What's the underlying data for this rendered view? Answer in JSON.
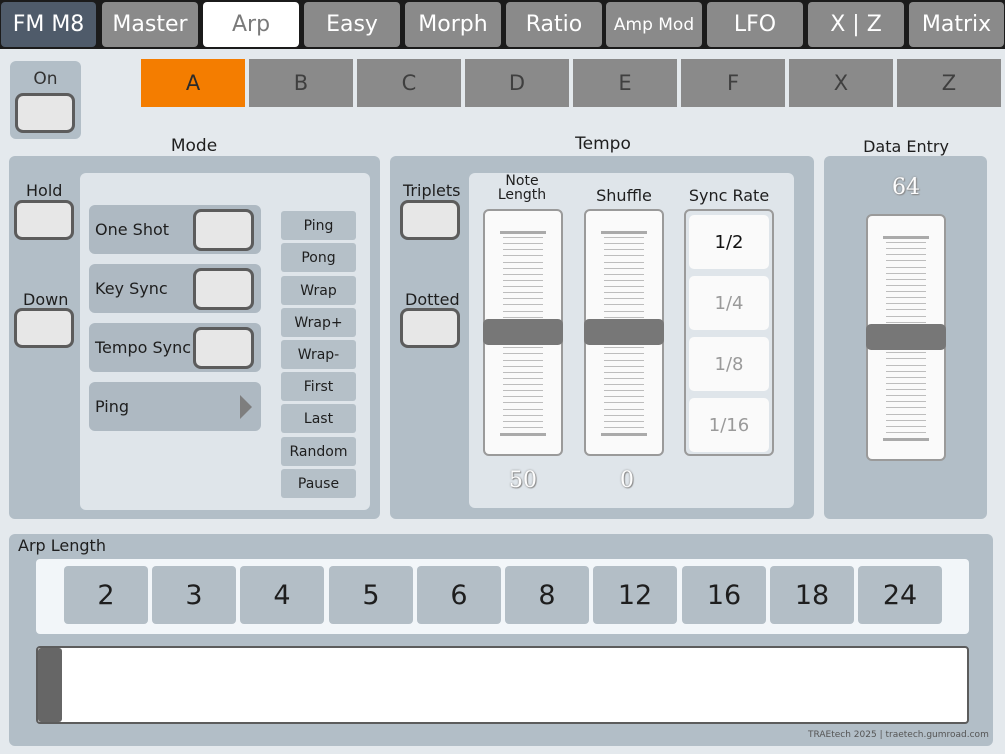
{
  "top_tabs": [
    {
      "label": "FM M8"
    },
    {
      "label": "Master"
    },
    {
      "label": "Arp"
    },
    {
      "label": "Easy"
    },
    {
      "label": "Morph"
    },
    {
      "label": "Ratio"
    },
    {
      "label": "Amp Mod"
    },
    {
      "label": "LFO"
    },
    {
      "label": "X | Z"
    },
    {
      "label": "Matrix"
    }
  ],
  "active_top_tab": "Arp",
  "on_toggle": {
    "label": "On",
    "state": "off"
  },
  "sub_tabs": [
    {
      "label": "A"
    },
    {
      "label": "B"
    },
    {
      "label": "C"
    },
    {
      "label": "D"
    },
    {
      "label": "E"
    },
    {
      "label": "F"
    },
    {
      "label": "X"
    },
    {
      "label": "Z"
    }
  ],
  "active_sub_tab": "A",
  "mode": {
    "title": "Mode",
    "hold_label": "Hold",
    "down_label": "Down",
    "one_shot_label": "One Shot",
    "key_sync_label": "Key Sync",
    "tempo_sync_label": "Tempo Sync",
    "pattern_selected": "Ping",
    "pattern_options": [
      "Ping",
      "Pong",
      "Wrap",
      "Wrap+",
      "Wrap-",
      "First",
      "Last",
      "Random",
      "Pause"
    ]
  },
  "tempo": {
    "title": "Tempo",
    "triplets_label": "Triplets",
    "dotted_label": "Dotted",
    "note_length_label_1": "Note",
    "note_length_label_2": "Length",
    "note_length_value": "50",
    "note_length_level": 0.5,
    "shuffle_label": "Shuffle",
    "shuffle_value": "0",
    "shuffle_level": 0.5,
    "sync_rate_label": "Sync Rate",
    "sync_rates": [
      "1/2",
      "1/4",
      "1/8",
      "1/16"
    ],
    "sync_rate_selected": "1/2"
  },
  "data_entry": {
    "title": "Data Entry",
    "value": "64",
    "level": 0.5
  },
  "arp_length": {
    "title": "Arp Length",
    "options": [
      "2",
      "3",
      "4",
      "5",
      "6",
      "8",
      "12",
      "16",
      "18",
      "24"
    ],
    "progress": 0
  },
  "footer_credit": "TRAEtech 2025 | traetech.gumroad.com",
  "colors": {
    "accent": "#f47d00",
    "panel": "#b2bec7",
    "tab": "#8a8a8a"
  }
}
